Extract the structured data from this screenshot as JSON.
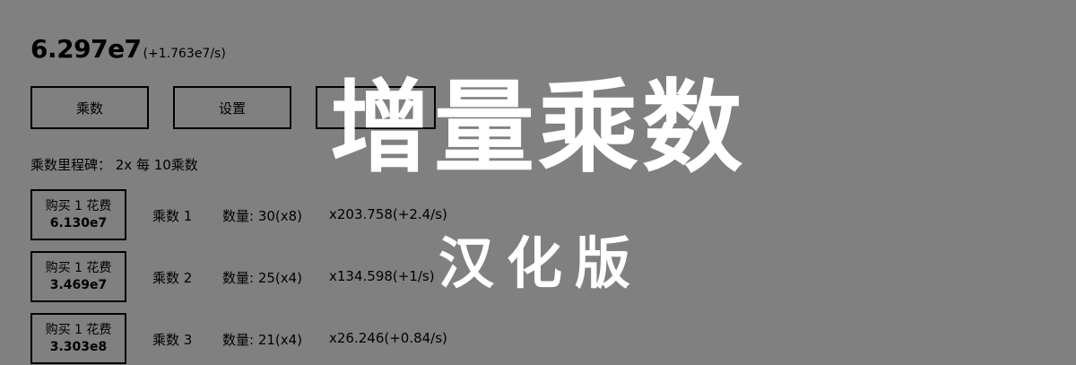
{
  "points": {
    "value": "6.297e7",
    "rate": "(+1.763e7/s)"
  },
  "tabs": [
    {
      "label": "乘数"
    },
    {
      "label": "设置"
    },
    {
      "label": ""
    }
  ],
  "milestone": {
    "text": "乘数里程碑：  2x 每 10乘数"
  },
  "multipliers": [
    {
      "buy_label": "购买 1 花费",
      "cost": "6.130e7",
      "name": "乘数 1",
      "amount": "数量: 30(x8)",
      "mult": "x203.758(+2.4/s)"
    },
    {
      "buy_label": "购买 1 花费",
      "cost": "3.469e7",
      "name": "乘数 2",
      "amount": "数量: 25(x4)",
      "mult": "x134.598(+1/s)"
    },
    {
      "buy_label": "购买 1 花费",
      "cost": "3.303e8",
      "name": "乘数 3",
      "amount": "数量: 21(x4)",
      "mult": "x26.246(+0.84/s)"
    }
  ],
  "overlay": {
    "title": "增量乘数",
    "subtitle": "汉化版"
  }
}
